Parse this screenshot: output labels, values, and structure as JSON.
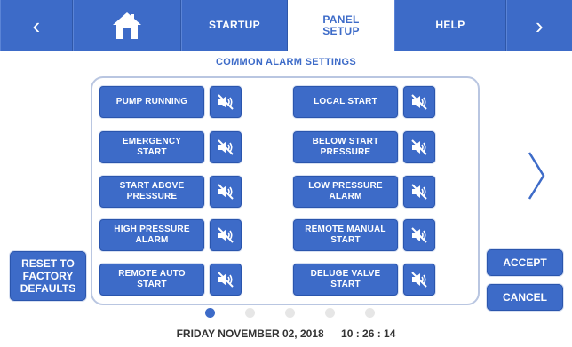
{
  "nav": {
    "back_icon": "chevron-left-icon",
    "home_icon": "home-icon",
    "tabs": [
      {
        "label": "STARTUP"
      },
      {
        "label_line1": "PANEL",
        "label_line2": "SETUP"
      },
      {
        "label": "HELP"
      }
    ],
    "next_icon": "chevron-right-icon"
  },
  "section_title": "COMMON ALARM SETTINGS",
  "alarms_left": [
    {
      "line1": "PUMP RUNNING",
      "line2": ""
    },
    {
      "line1": "EMERGENCY",
      "line2": "START"
    },
    {
      "line1": "START ABOVE",
      "line2": "PRESSURE"
    },
    {
      "line1": "HIGH PRESSURE",
      "line2": "ALARM"
    },
    {
      "line1": "REMOTE AUTO",
      "line2": "START"
    }
  ],
  "alarms_right": [
    {
      "line1": "LOCAL START",
      "line2": ""
    },
    {
      "line1": "BELOW START",
      "line2": "PRESSURE"
    },
    {
      "line1": "LOW PRESSURE",
      "line2": "ALARM"
    },
    {
      "line1": "REMOTE MANUAL",
      "line2": "START"
    },
    {
      "line1": "DELUGE VALVE",
      "line2": "START"
    }
  ],
  "mute_icon": "speaker-muted-icon",
  "reset_button": {
    "line1": "RESET TO",
    "line2": "FACTORY",
    "line3": "DEFAULTS"
  },
  "accept_button": "ACCEPT",
  "cancel_button": "CANCEL",
  "pagination": {
    "current_page": 1,
    "total_pages": 5
  },
  "footer": {
    "date": "FRIDAY NOVEMBER 02, 2018",
    "time": "10 : 26 : 14"
  },
  "colors": {
    "accent": "#3d6bc8",
    "panel_border": "#b9c6e1",
    "dot_inactive": "#e6e6e6"
  }
}
